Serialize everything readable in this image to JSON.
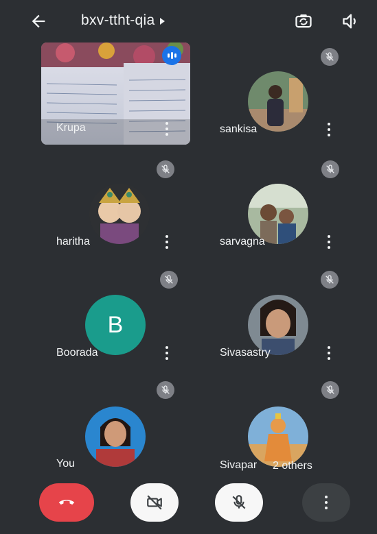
{
  "header": {
    "meeting_code": "bxv-ttht-qia",
    "back_icon": "arrow-left-icon",
    "switch_camera_icon": "switch-camera-icon",
    "speaker_icon": "speaker-icon"
  },
  "participants": [
    {
      "name": "Krupa",
      "type": "video",
      "speaking": true
    },
    {
      "name": "sankisa",
      "type": "photo",
      "muted": true
    },
    {
      "name": "haritha",
      "type": "photo",
      "muted": true
    },
    {
      "name": "sarvagna",
      "type": "photo",
      "muted": true
    },
    {
      "name": "Boorada",
      "type": "letter",
      "letter": "B",
      "muted": true
    },
    {
      "name": "Sivasastry",
      "type": "photo",
      "muted": true
    },
    {
      "name": "You",
      "type": "photo",
      "muted": true
    },
    {
      "name": "Sivapar",
      "type": "photo",
      "muted": true,
      "overlay": "2 others"
    }
  ],
  "controls": {
    "end_call_icon": "phone-hangup-icon",
    "camera_icon": "camera-off-icon",
    "mic_icon": "mic-off-icon",
    "more_icon": "more-vertical-icon"
  },
  "colors": {
    "background": "#2c2f33",
    "end_call": "#e6444a",
    "avatar_teal": "#1a9c8c",
    "speaking_badge": "#1a73e8"
  }
}
